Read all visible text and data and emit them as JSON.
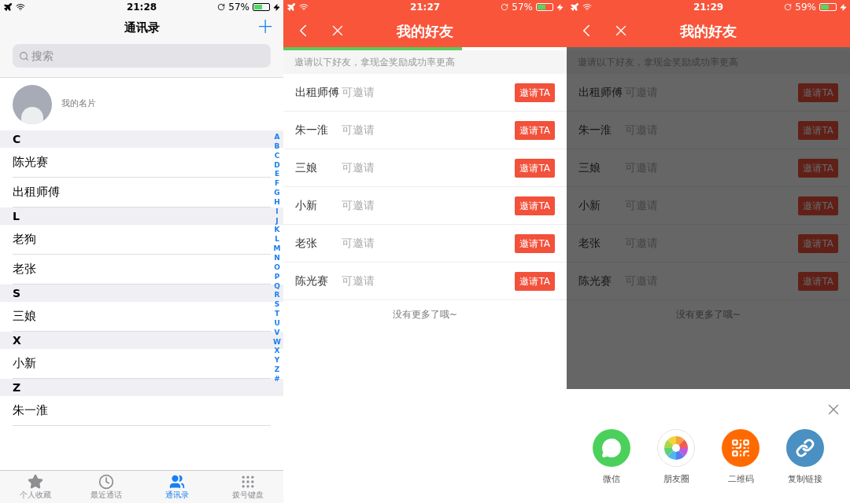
{
  "contacts_screen": {
    "status_bar": {
      "time": "21:28",
      "battery": "57%"
    },
    "title": "通讯录",
    "add_button": "+",
    "search": {
      "placeholder": "搜索"
    },
    "my_card": "我的名片",
    "sections": [
      {
        "letter": "C",
        "contacts": [
          "陈光赛",
          "出租师傅"
        ]
      },
      {
        "letter": "L",
        "contacts": [
          "老狗",
          "老张"
        ]
      },
      {
        "letter": "S",
        "contacts": [
          "三娘"
        ]
      },
      {
        "letter": "X",
        "contacts": [
          "小新"
        ]
      },
      {
        "letter": "Z",
        "contacts": [
          "朱一淮"
        ]
      }
    ],
    "index_letters": [
      "A",
      "B",
      "C",
      "D",
      "E",
      "F",
      "G",
      "H",
      "I",
      "J",
      "K",
      "L",
      "M",
      "N",
      "O",
      "P",
      "Q",
      "R",
      "S",
      "T",
      "U",
      "V",
      "W",
      "X",
      "Y",
      "Z",
      "#"
    ],
    "tabs": [
      {
        "label": "个人收藏",
        "kind": "star",
        "selected": false
      },
      {
        "label": "最近通话",
        "kind": "clock",
        "selected": false
      },
      {
        "label": "通讯录",
        "kind": "people",
        "selected": true
      },
      {
        "label": "拨号键盘",
        "kind": "keypad",
        "selected": false
      }
    ]
  },
  "friends_screen": {
    "status_bar": {
      "time": "21:27",
      "battery": "57%"
    },
    "title": "我的好友",
    "page_load": {
      "level": 0.63
    },
    "notice": "邀请以下好友，拿现金奖励成功率更高",
    "friends": [
      {
        "name": "出租师傅",
        "status": "可邀请",
        "button": "邀请TA"
      },
      {
        "name": "朱一淮",
        "status": "可邀请",
        "button": "邀请TA"
      },
      {
        "name": "三娘",
        "status": "可邀请",
        "button": "邀请TA"
      },
      {
        "name": "小新",
        "status": "可邀请",
        "button": "邀请TA"
      },
      {
        "name": "老张",
        "status": "可邀请",
        "button": "邀请TA"
      },
      {
        "name": "陈光赛",
        "status": "可邀请",
        "button": "邀请TA"
      }
    ],
    "footer": "没有更多了哦~"
  },
  "share_screen": {
    "status_bar": {
      "time": "21:29",
      "battery": "59%"
    },
    "title": "我的好友",
    "notice": "邀请以下好友，拿现金奖励成功率更高",
    "friends": [
      {
        "name": "出租师傅",
        "status": "可邀请",
        "button": "邀请TA"
      },
      {
        "name": "朱一淮",
        "status": "可邀请",
        "button": "邀请TA"
      },
      {
        "name": "三娘",
        "status": "可邀请",
        "button": "邀请TA"
      },
      {
        "name": "小新",
        "status": "可邀请",
        "button": "邀请TA"
      },
      {
        "name": "老张",
        "status": "可邀请",
        "button": "邀请TA"
      },
      {
        "name": "陈光赛",
        "status": "可邀请",
        "button": "邀请TA"
      }
    ],
    "footer": "没有更多了哦~",
    "share_options": [
      {
        "label": "微信",
        "kind": "wechat"
      },
      {
        "label": "朋友圈",
        "kind": "moments"
      },
      {
        "label": "二维码",
        "kind": "qrcode"
      },
      {
        "label": "复制链接",
        "kind": "link"
      }
    ]
  }
}
